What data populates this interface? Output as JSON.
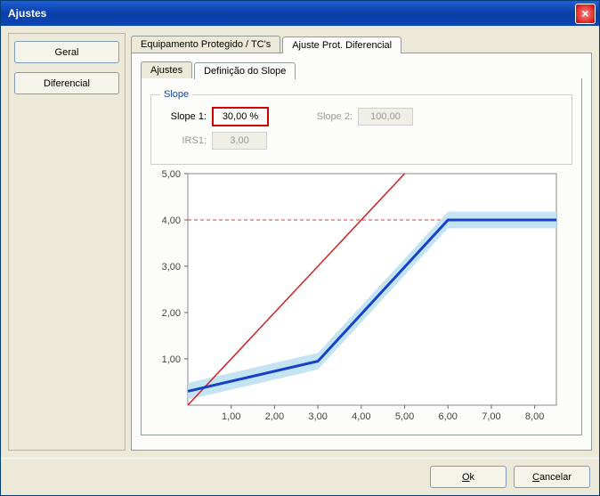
{
  "window": {
    "title": "Ajustes"
  },
  "left": {
    "geral": "Geral",
    "diferencial": "Diferencial"
  },
  "tabs": {
    "equip": "Equipamento Protegido / TC's",
    "ajuste": "Ajuste Prot. Diferencial"
  },
  "subtabs": {
    "ajustes": "Ajustes",
    "slope": "Definição do Slope"
  },
  "slope": {
    "legend": "Slope",
    "label1": "Slope 1:",
    "value1": "30,00 %",
    "label2": "Slope 2:",
    "value2": "100,00",
    "labelIRS": "IRS1:",
    "valueIRS": "3,00"
  },
  "footer": {
    "ok": "Ok",
    "cancel": "Cancelar"
  },
  "chart_data": {
    "type": "line",
    "xlabel": "",
    "ylabel": "",
    "xlim": [
      0,
      8.5
    ],
    "ylim": [
      0,
      5
    ],
    "xticks": [
      "1,00",
      "2,00",
      "3,00",
      "4,00",
      "5,00",
      "6,00",
      "7,00",
      "8,00"
    ],
    "yticks": [
      "1,00",
      "2,00",
      "3,00",
      "4,00",
      "5,00"
    ],
    "reference_line": {
      "y": 4.0
    },
    "series": [
      {
        "name": "diagonal",
        "color": "#d02020",
        "points": [
          [
            0,
            0
          ],
          [
            5,
            5
          ]
        ]
      },
      {
        "name": "characteristic",
        "color": "#1542c8",
        "thick": true,
        "points": [
          [
            0,
            0.3
          ],
          [
            3,
            0.95
          ],
          [
            6,
            4.0
          ],
          [
            8.5,
            4.0
          ]
        ]
      }
    ],
    "band": {
      "around": "characteristic",
      "width": 0.18
    }
  }
}
